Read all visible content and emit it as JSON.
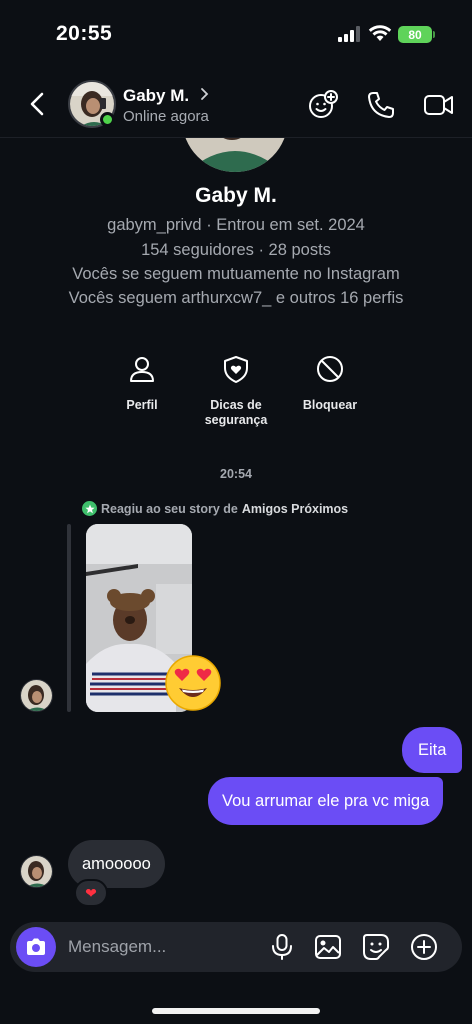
{
  "status_bar": {
    "time": "20:55",
    "battery": "80"
  },
  "header": {
    "name": "Gaby M.",
    "status": "Online agora",
    "icons": [
      "back-icon",
      "chevron-right-icon",
      "effects-icon",
      "phone-icon",
      "video-icon"
    ]
  },
  "profile": {
    "name": "Gaby M.",
    "username_line": "gabym_privd · Entrou em set. 2024",
    "followers_line": "154 seguidores · 28 posts",
    "mutual_line": "Vocês se seguem mutuamente no Instagram",
    "follows_line": "Vocês seguem arthurxcw7_ e outros 16 perfis"
  },
  "actions": [
    {
      "label": "Perfil",
      "icon": "person-icon"
    },
    {
      "label": "Dicas de\nsegurança",
      "icon": "shield-heart-icon"
    },
    {
      "label": "Bloquear",
      "icon": "block-icon"
    }
  ],
  "conversation": {
    "timestamp": "20:54",
    "story_reply_prefix": "Reagiu ao seu story de",
    "story_reply_audience": "Amigos Próximos",
    "story_reaction": "😍",
    "messages": [
      {
        "from": "me",
        "text": "Eita"
      },
      {
        "from": "me",
        "text": "Vou arrumar ele pra vc miga"
      },
      {
        "from": "them",
        "text": "amooooo",
        "reaction": "❤"
      }
    ]
  },
  "composer": {
    "placeholder": "Mensagem..."
  },
  "colors": {
    "accent": "#6b4df5",
    "background": "#0c0f14",
    "incoming_bubble": "#2a2d34",
    "online": "#4fd34b"
  }
}
